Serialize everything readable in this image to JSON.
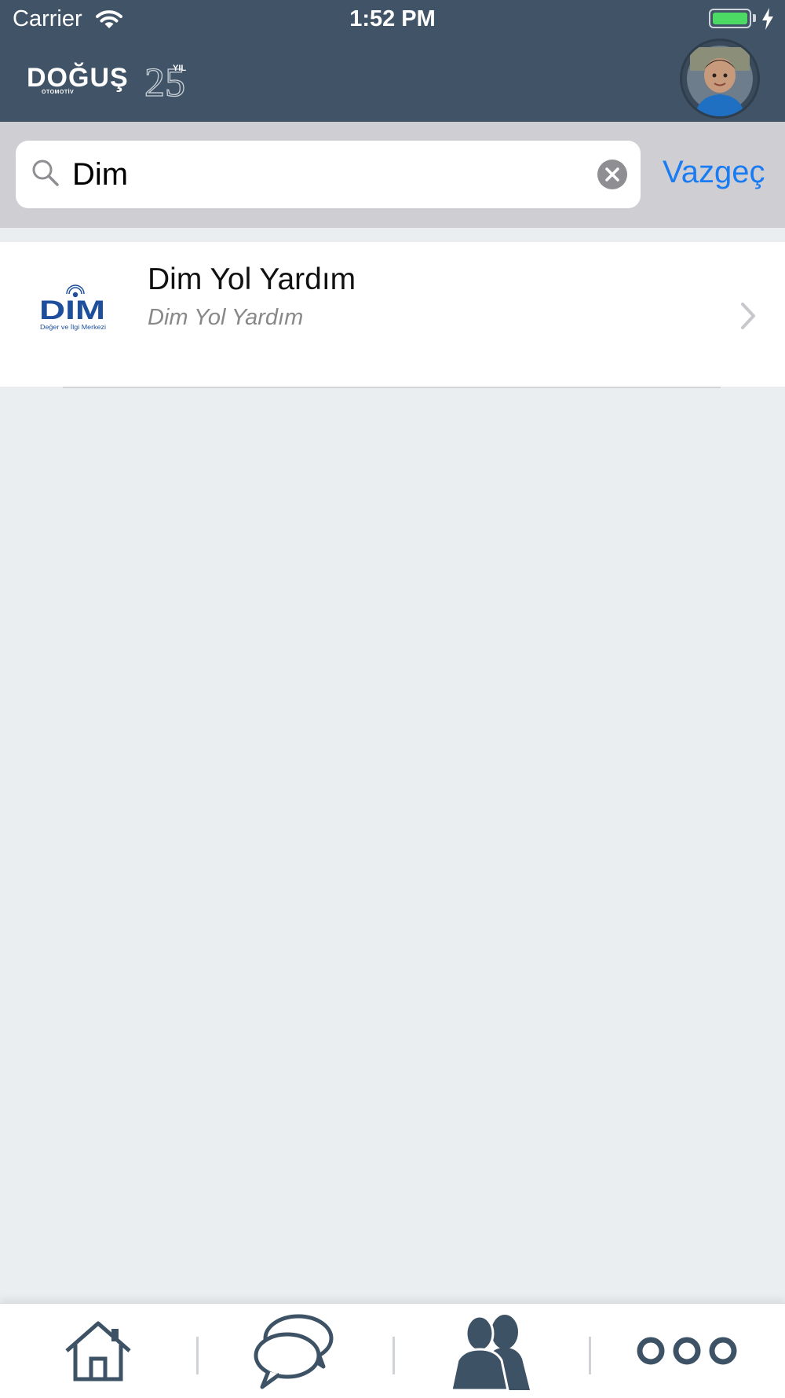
{
  "status_bar": {
    "carrier": "Carrier",
    "time": "1:52 PM"
  },
  "header": {
    "brand": "DOĞUŞ",
    "brand_sub": "OTOMOTİV",
    "anniversary_number": "25",
    "anniversary_label": "YIL",
    "background_color": "#415467"
  },
  "search": {
    "value": "Dim",
    "cancel_label": "Vazgeç",
    "accent_color": "#1a7cf2"
  },
  "results": [
    {
      "title": "Dim Yol Yardım",
      "subtitle": "Dim Yol Yardım",
      "logo_text": "DIM",
      "logo_subtext": "Değer ve İlgi Merkezi"
    }
  ],
  "tabbar": {
    "tabs": [
      {
        "icon": "home-icon"
      },
      {
        "icon": "chat-icon"
      },
      {
        "icon": "contacts-icon"
      },
      {
        "icon": "more-icon"
      }
    ]
  }
}
